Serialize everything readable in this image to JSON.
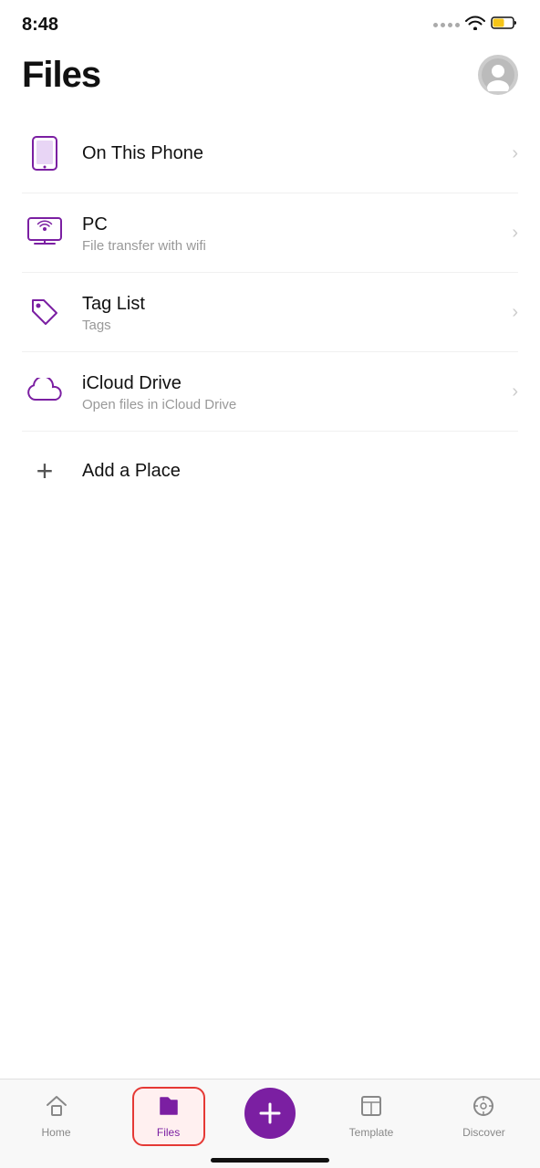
{
  "statusBar": {
    "time": "8:48"
  },
  "header": {
    "title": "Files"
  },
  "listItems": [
    {
      "id": "on-this-phone",
      "title": "On This Phone",
      "subtitle": null,
      "iconType": "phone",
      "hasChevron": true
    },
    {
      "id": "pc",
      "title": "PC",
      "subtitle": "File transfer with wifi",
      "iconType": "pc",
      "hasChevron": true
    },
    {
      "id": "tag-list",
      "title": "Tag List",
      "subtitle": "Tags",
      "iconType": "tag",
      "hasChevron": true
    },
    {
      "id": "icloud-drive",
      "title": "iCloud Drive",
      "subtitle": "Open files in iCloud Drive",
      "iconType": "cloud",
      "hasChevron": true
    },
    {
      "id": "add-place",
      "title": "Add a Place",
      "subtitle": null,
      "iconType": "plus",
      "hasChevron": false
    }
  ],
  "bottomNav": {
    "items": [
      {
        "id": "home",
        "label": "Home",
        "iconType": "home",
        "active": false
      },
      {
        "id": "files",
        "label": "Files",
        "iconType": "files",
        "active": true
      },
      {
        "id": "add",
        "label": "",
        "iconType": "plus-circle",
        "active": false
      },
      {
        "id": "template",
        "label": "Template",
        "iconType": "template",
        "active": false
      },
      {
        "id": "discover",
        "label": "Discover",
        "iconType": "discover",
        "active": false
      }
    ]
  }
}
